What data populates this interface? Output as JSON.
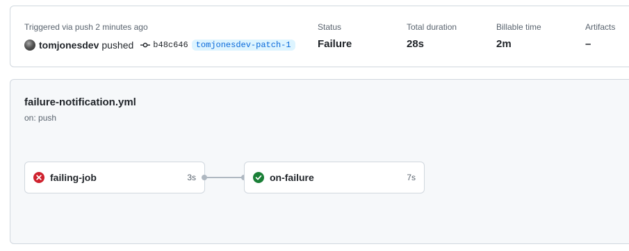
{
  "summary": {
    "trigger_label": "Triggered via push 2 minutes ago",
    "actor": "tomjonesdev",
    "action": "pushed",
    "commit_sha": "b48c646",
    "branch": "tomjonesdev-patch-1",
    "stats": [
      {
        "label": "Status",
        "value": "Failure"
      },
      {
        "label": "Total duration",
        "value": "28s"
      },
      {
        "label": "Billable time",
        "value": "2m"
      },
      {
        "label": "Artifacts",
        "value": "–"
      }
    ]
  },
  "workflow": {
    "filename": "failure-notification.yml",
    "trigger": "on: push",
    "jobs": [
      {
        "name": "failing-job",
        "duration": "3s",
        "status": "failure",
        "icon": "x-circle-icon"
      },
      {
        "name": "on-failure",
        "duration": "7s",
        "status": "success",
        "icon": "check-circle-icon"
      }
    ]
  },
  "colors": {
    "failure": "#cf222e",
    "success": "#1a7f37",
    "link": "#0969da",
    "branch_bg": "#ddf4ff"
  }
}
